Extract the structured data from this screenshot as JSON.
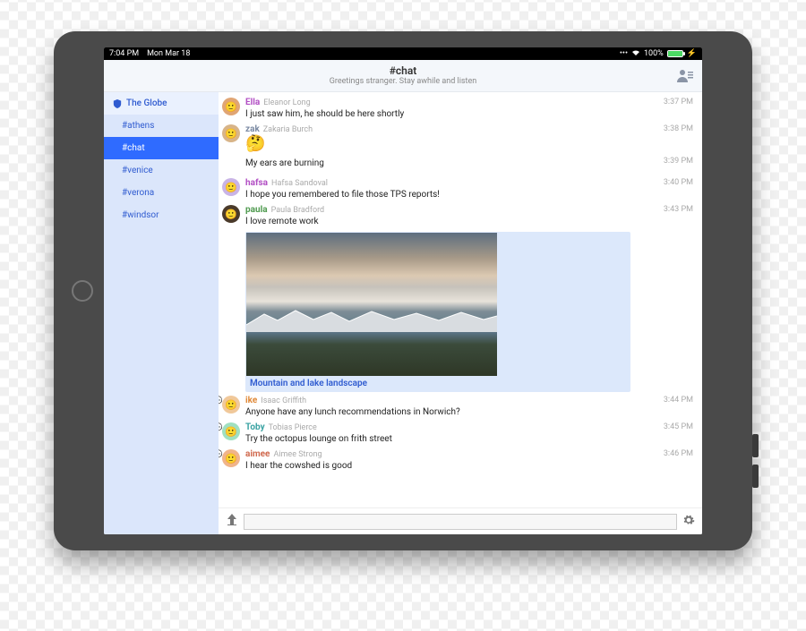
{
  "status": {
    "time": "7:04 PM",
    "date": "Mon Mar 18",
    "battery_pct": "100%"
  },
  "header": {
    "title": "#chat",
    "subtitle": "Greetings stranger. Stay awhile and listen"
  },
  "sidebar": {
    "org": "The Globe",
    "channels": [
      "#athens",
      "#chat",
      "#venice",
      "#verona",
      "#windsor"
    ],
    "active": "#chat"
  },
  "messages": [
    {
      "user": "Ella",
      "full": "Eleanor Long",
      "color": "#b24fc4",
      "avatar_bg": "#e0a574",
      "text": "I just saw him, he should be here shortly",
      "time": "3:37 PM"
    },
    {
      "user": "zak",
      "full": "Zakaria Burch",
      "color": "#7b8aa3",
      "avatar_bg": "#d8b488",
      "emoji": "🤔",
      "time": "3:38 PM"
    },
    {
      "user": "",
      "full": "",
      "color": "",
      "avatar_bg": "",
      "text": "My ears are burning",
      "time": "3:39 PM",
      "continuation": true
    },
    {
      "user": "hafsa",
      "full": "Hafsa Sandoval",
      "color": "#b24fc4",
      "avatar_bg": "#c9b4e6",
      "text": "I hope you remembered to file those TPS reports!",
      "time": "3:40 PM"
    },
    {
      "user": "paula",
      "full": "Paula Bradford",
      "color": "#4f9a4f",
      "avatar_bg": "#4a3a2a",
      "text": "I love remote work",
      "time": "3:43 PM",
      "attachment_caption": "Mountain and lake landscape"
    },
    {
      "user": "ike",
      "full": "Isaac Griffith",
      "color": "#e08a3a",
      "avatar_bg": "#f0c89a",
      "text": "Anyone have any lunch recommendations in Norwich?",
      "time": "3:44 PM",
      "typing": true
    },
    {
      "user": "Toby",
      "full": "Tobias Pierce",
      "color": "#3aa3a3",
      "avatar_bg": "#a0e0c0",
      "text": "Try the octopus lounge on frith street",
      "time": "3:45 PM",
      "typing": true
    },
    {
      "user": "aimee",
      "full": "Aimee Strong",
      "color": "#d06a4f",
      "avatar_bg": "#f0b48a",
      "text": "I hear the cowshed is good",
      "time": "3:46 PM",
      "typing": true
    }
  ],
  "composer": {
    "placeholder": ""
  }
}
